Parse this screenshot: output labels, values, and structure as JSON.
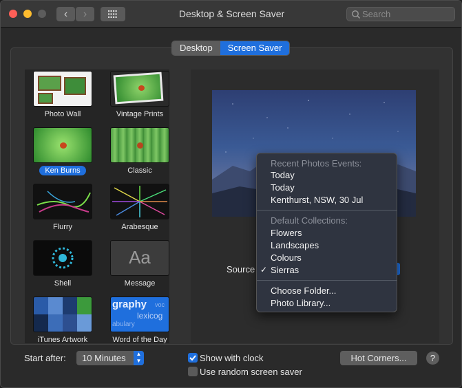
{
  "window": {
    "title": "Desktop & Screen Saver"
  },
  "search": {
    "placeholder": "Search"
  },
  "tabs": {
    "desktop": "Desktop",
    "screen_saver": "Screen Saver"
  },
  "savers": [
    {
      "label": "Photo Wall"
    },
    {
      "label": "Vintage Prints"
    },
    {
      "label": "Ken Burns"
    },
    {
      "label": "Classic"
    },
    {
      "label": "Flurry"
    },
    {
      "label": "Arabesque"
    },
    {
      "label": "Shell"
    },
    {
      "label": "Message"
    },
    {
      "label": "iTunes Artwork"
    },
    {
      "label": "Word of the Day"
    }
  ],
  "message_thumb": "Aa",
  "word_thumb": {
    "line1": "graphy",
    "line2": "voc",
    "line3": "lexicog",
    "line4": "abulary"
  },
  "source": {
    "label": "Source"
  },
  "menu": {
    "recent_header": "Recent Photos Events:",
    "recent": [
      "Today",
      "Today",
      "Kenthurst, NSW, 30 Jul"
    ],
    "default_header": "Default Collections:",
    "collections": [
      "Flowers",
      "Landscapes",
      "Colours",
      "Sierras"
    ],
    "selected": "Sierras",
    "actions": [
      "Choose Folder...",
      "Photo Library..."
    ]
  },
  "bottom": {
    "start_after_label": "Start after:",
    "start_after_value": "10 Minutes",
    "show_clock": "Show with clock",
    "random_saver": "Use random screen saver",
    "hot_corners": "Hot Corners...",
    "help": "?"
  }
}
